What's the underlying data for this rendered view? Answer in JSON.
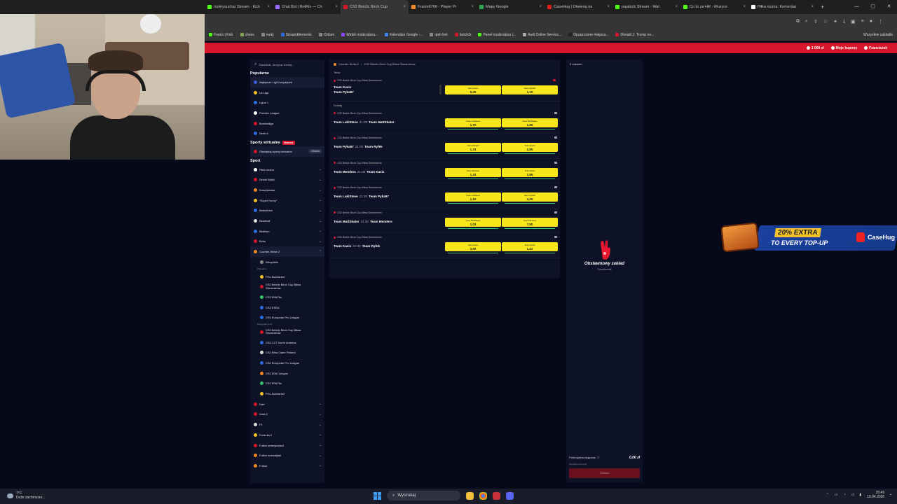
{
  "browser": {
    "tabs": [
      {
        "label": "mokrysuchar Stream - Kick",
        "color": "#53fc18"
      },
      {
        "label": "Chat Bot | BotRix — Ch",
        "color": "#9b6bff"
      },
      {
        "label": "CS2 Betclic Birch Cup",
        "color": "#d8162b",
        "active": true
      },
      {
        "label": "Franio6769 - Player Pr",
        "color": "#f08a24"
      },
      {
        "label": "Mapy Google",
        "color": "#34a853"
      },
      {
        "label": "CaseHug | Otwieraj na",
        "color": "#e02020"
      },
      {
        "label": "pajalock Stream - Wat",
        "color": "#53fc18"
      },
      {
        "label": "Co to za Hit! - Muzyce",
        "color": "#53fc18"
      },
      {
        "label": "Piłka nożna: Komentar",
        "color": "#ffffff"
      }
    ],
    "bookmarks": [
      {
        "label": "Franio | Kick",
        "color": "#53fc18"
      },
      {
        "label": "chess",
        "color": "#7fa650"
      },
      {
        "label": "nudy",
        "color": "#888888"
      },
      {
        "label": "StreamElements",
        "color": "#2d6cdf"
      },
      {
        "label": "Chilam",
        "color": "#888888"
      },
      {
        "label": "Widok moderatora...",
        "color": "#9146ff"
      },
      {
        "label": "Kalendarz Google -...",
        "color": "#4285f4"
      },
      {
        "label": "ujeb link",
        "color": "#888888"
      },
      {
        "label": "betclick",
        "color": "#d8162b"
      },
      {
        "label": "Panel moderatora |...",
        "color": "#53fc18"
      },
      {
        "label": "Audi Online Service...",
        "color": "#aaaaaa"
      },
      {
        "label": "Opuszczone miejsca...",
        "color": "#222222"
      },
      {
        "label": "Donald J. Trump ne...",
        "color": "#d8162b"
      }
    ],
    "bookmarks_all": "Wszystkie zakładki"
  },
  "topbar": {
    "balance": "1 000 zł",
    "my_coupons": "Moje kupony",
    "user": "Franciszek"
  },
  "sidebar": {
    "search_placeholder": "Zawodnik, drużyna, turniej...",
    "popular_title": "Popularne",
    "popular": [
      {
        "label": "Najlepsze Ligi Europejskie",
        "color": "#3b5bdb"
      },
      {
        "label": "La Liga",
        "color": "#f1c12a"
      },
      {
        "label": "Ligue 1",
        "color": "#2d6cdf"
      },
      {
        "label": "Premier League",
        "color": "#ffffff"
      },
      {
        "label": "Bundesliga",
        "color": "#d8162b"
      },
      {
        "label": "Serie A",
        "color": "#2d6cdf"
      }
    ],
    "virtual_title": "Sporty wirtualne",
    "virtual_badge": "Nowość",
    "virtual_item": "Obstawiaj sporty wirtualne",
    "virtual_btn": "Obstaw",
    "sport_title": "Sport",
    "sports": [
      "Piłka nożna",
      "Sztuki Walki",
      "Koszykówka",
      "*Super Kursy*",
      "Badminton",
      "Baseball",
      "Biathlon",
      "Boks"
    ],
    "cs2": {
      "label": "Counter-Strike 2",
      "all": "Wszystkie",
      "popular_head": "Popularne",
      "popular": [
        {
          "label": "PGL Bucharest",
          "color": "#f1c12a"
        },
        {
          "label": "CS2 Betclic Birch Cup Bitwa Streamerów",
          "color": "#d8162b"
        },
        {
          "label": "CS2 IEM Rio",
          "color": "#37c46b"
        },
        {
          "label": "CS2 ESEA",
          "color": "#2d6cdf"
        },
        {
          "label": "CS2 European Pro League",
          "color": "#2d6cdf"
        }
      ],
      "comp_head": "Rozgrywki (A-Z)",
      "comps": [
        {
          "label": "CS2 Betclic Birch Cup Bitwa Streamerów",
          "color": "#d8162b"
        },
        {
          "label": "CS2 CCT North America",
          "color": "#2d6cdf"
        },
        {
          "label": "CS2 Elisa Open Finland",
          "color": "#dddddd"
        },
        {
          "label": "CS2 European Pro League",
          "color": "#2d6cdf"
        },
        {
          "label": "CS2 IEM Cologne",
          "color": "#f08a24"
        },
        {
          "label": "CS2 IEM Rio",
          "color": "#37c46b"
        },
        {
          "label": "PGL Bucharest",
          "color": "#f1c12a"
        }
      ]
    },
    "sports_after": [
      "Dart",
      "Dota 2",
      "F1",
      "Formuła 2",
      "Futbol amerykański",
      "Futbol australijski",
      "Futsal"
    ]
  },
  "center": {
    "breadcrumb_sport": "Counter-Strike 2",
    "breadcrumb_comp": "CS2 Betclic Birch Cup Bitwa Streamerów",
    "now_label": "Teraz",
    "today_label": "Dzisiaj",
    "competition": "CS2 Betclic Birch Cup Bitwa Streamerów",
    "live": {
      "team1": "Team Kasix",
      "team2": "Team Pyka97",
      "odd1_label": "Team Kasix",
      "odd1": "5,25",
      "odd2_label": "Team Pyka97",
      "odd2": "1,10"
    },
    "matches": [
      {
        "team1": "Team LukiSteve",
        "time": "21:00",
        "team2": "Team MattSkater",
        "odd1": "1,70",
        "odd2": "1,95"
      },
      {
        "team1": "Team Pyka97",
        "time": "21:00",
        "team2": "Team Ryfek",
        "odd1": "1,33",
        "odd2": "2,85"
      },
      {
        "team1": "Team Menders",
        "time": "21:00",
        "team2": "Team Kasix",
        "odd1": "1,33",
        "odd2": "2,85"
      },
      {
        "team1": "Team LukiSteve",
        "time": "21:30",
        "team2": "Team Pyka97",
        "odd1": "1,15",
        "odd2": "4,25"
      },
      {
        "team1": "Team MattSkater",
        "time": "21:30",
        "team2": "Team Menders",
        "odd1": "1,03",
        "odd2": "7,50"
      },
      {
        "team1": "Team Kasix",
        "time": "21:30",
        "team2": "Team Ryfek",
        "odd1": "3,50",
        "odd2": "1,22"
      }
    ]
  },
  "slip": {
    "title": "0 zdarzeń",
    "empty_title": "Obstawnowy zakład",
    "empty_sub": "Powodzenia!",
    "potential_label": "Potencjalna wygrana:",
    "potential_value": "0,00 zł",
    "sub_label": "Współczynnik 0,00",
    "button": "Obstaw"
  },
  "promo": {
    "extra": "20% EXTRA",
    "topup": "TO EVERY TOP-UP",
    "brand": "CaseHug"
  },
  "taskbar": {
    "temp": "7°C",
    "weather": "Duże zachmurze...",
    "search": "Wyszukaj",
    "time": "20:49",
    "date": "10.04.2026"
  }
}
